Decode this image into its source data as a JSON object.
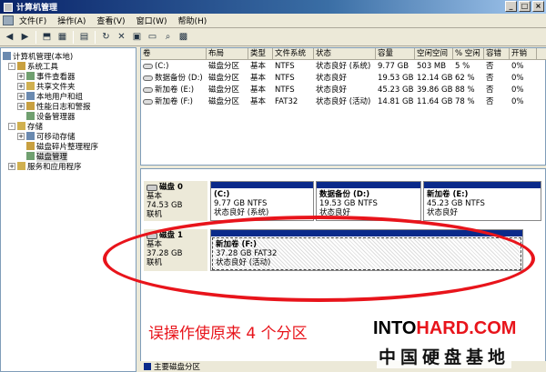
{
  "window": {
    "title": "计算机管理"
  },
  "menu": [
    "文件(F)",
    "操作(A)",
    "查看(V)",
    "窗口(W)",
    "帮助(H)"
  ],
  "tree": [
    {
      "label": "计算机管理(本地)",
      "level": 0,
      "ex": "",
      "icon": "computer-icon"
    },
    {
      "label": "系统工具",
      "level": 1,
      "ex": "-",
      "icon": "tools-icon"
    },
    {
      "label": "事件查看器",
      "level": 2,
      "ex": "+",
      "icon": "event-viewer-icon"
    },
    {
      "label": "共享文件夹",
      "level": 2,
      "ex": "+",
      "icon": "shared-folder-icon"
    },
    {
      "label": "本地用户和组",
      "level": 2,
      "ex": "+",
      "icon": "users-icon"
    },
    {
      "label": "性能日志和警报",
      "level": 2,
      "ex": "+",
      "icon": "performance-icon"
    },
    {
      "label": "设备管理器",
      "level": 2,
      "ex": "",
      "icon": "device-manager-icon"
    },
    {
      "label": "存储",
      "level": 1,
      "ex": "-",
      "icon": "storage-icon"
    },
    {
      "label": "可移动存储",
      "level": 2,
      "ex": "+",
      "icon": "removable-storage-icon"
    },
    {
      "label": "磁盘碎片整理程序",
      "level": 2,
      "ex": "",
      "icon": "defrag-icon"
    },
    {
      "label": "磁盘管理",
      "level": 2,
      "ex": "",
      "icon": "disk-management-icon"
    },
    {
      "label": "服务和应用程序",
      "level": 1,
      "ex": "+",
      "icon": "services-icon"
    }
  ],
  "list": {
    "columns": [
      "卷",
      "布局",
      "类型",
      "文件系统",
      "状态",
      "容量",
      "空闲空间",
      "% 空闲",
      "容错",
      "开销"
    ],
    "rows": [
      [
        "(C:)",
        "磁盘分区",
        "基本",
        "NTFS",
        "状态良好 (系统)",
        "9.77 GB",
        "503 MB",
        "5 %",
        "否",
        "0%"
      ],
      [
        "数据备份 (D:)",
        "磁盘分区",
        "基本",
        "NTFS",
        "状态良好",
        "19.53 GB",
        "12.14 GB",
        "62 %",
        "否",
        "0%"
      ],
      [
        "新加卷 (E:)",
        "磁盘分区",
        "基本",
        "NTFS",
        "状态良好",
        "45.23 GB",
        "39.86 GB",
        "88 %",
        "否",
        "0%"
      ],
      [
        "新加卷 (F:)",
        "磁盘分区",
        "基本",
        "FAT32",
        "状态良好 (活动)",
        "14.81 GB",
        "11.64 GB",
        "78 %",
        "否",
        "0%"
      ]
    ]
  },
  "disks": [
    {
      "name": "磁盘 0",
      "type": "基本",
      "size": "74.53 GB",
      "status": "联机",
      "parts": [
        {
          "name": "(C:)",
          "fs": "9.77 GB NTFS",
          "status": "状态良好 (系统)"
        },
        {
          "name": "数据备份 (D:)",
          "fs": "19.53 GB NTFS",
          "status": "状态良好"
        },
        {
          "name": "新加卷 (E:)",
          "fs": "45.23 GB NTFS",
          "status": "状态良好"
        }
      ]
    },
    {
      "name": "磁盘 1",
      "type": "基本",
      "size": "37.28 GB",
      "status": "联机",
      "parts": [
        {
          "name": "新加卷 (F:)",
          "fs": "37.28 GB FAT32",
          "status": "状态良好 (活动)"
        }
      ]
    }
  ],
  "legend": "主要磁盘分区",
  "annotation": {
    "caption": "误操作使原来 4 个分区",
    "watermark_a": "INTO",
    "watermark_b": "HARD.COM",
    "watermark_cn": "中国硬盘基地",
    "color": "#e8141b"
  }
}
